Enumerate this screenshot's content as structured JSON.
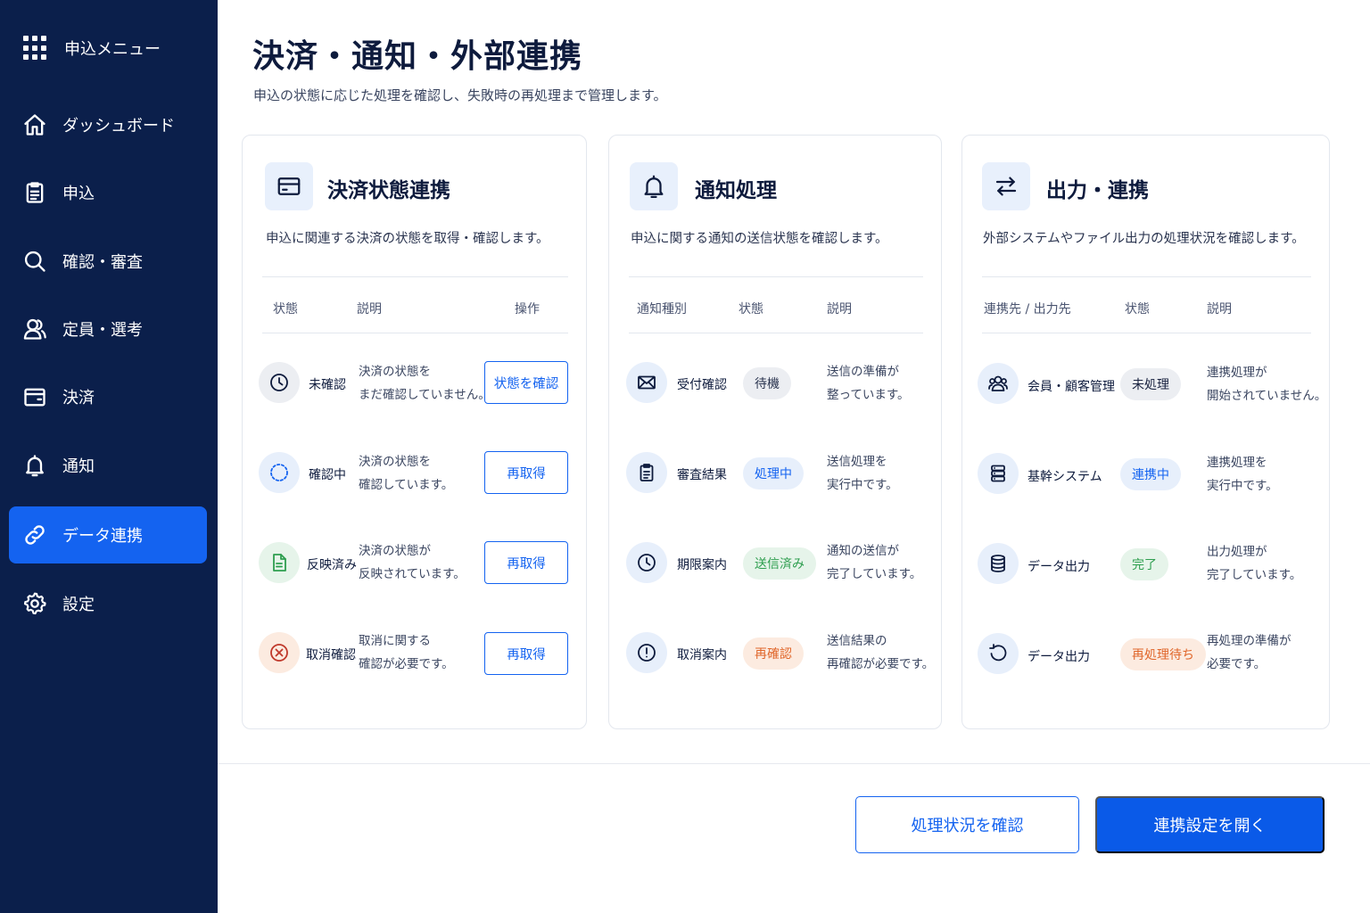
{
  "sidebar": {
    "menu_title": "申込メニュー",
    "items": [
      {
        "label": "ダッシュボード",
        "icon": "home-icon"
      },
      {
        "label": "申込",
        "icon": "clipboard-icon"
      },
      {
        "label": "確認・審査",
        "icon": "search-icon"
      },
      {
        "label": "定員・選考",
        "icon": "users-icon"
      },
      {
        "label": "決済",
        "icon": "wallet-icon"
      },
      {
        "label": "通知",
        "icon": "bell-icon"
      },
      {
        "label": "データ連携",
        "icon": "link-icon",
        "active": true
      },
      {
        "label": "設定",
        "icon": "gear-icon"
      }
    ]
  },
  "header": {
    "title": "決済・通知・外部連携",
    "subtitle": "申込の状態に応じた処理を確認し、失敗時の再処理まで管理します。"
  },
  "cards": {
    "payment": {
      "title": "決済状態連携",
      "icon": "card-icon",
      "description": "申込に関連する決済の状態を取得・確認します。",
      "headers": [
        "状態",
        "説明",
        "操作"
      ],
      "rows": [
        {
          "status": "未確認",
          "desc1": "決済の状態を",
          "desc2": "まだ確認していません。",
          "action": "状態を確認",
          "icon": "clock-icon"
        },
        {
          "status": "確認中",
          "desc1": "決済の状態を",
          "desc2": "確認しています。",
          "action": "再取得",
          "icon": "loading-icon"
        },
        {
          "status": "反映済み",
          "desc1": "決済の状態が",
          "desc2": "反映されています。",
          "action": "再取得",
          "icon": "document-icon"
        },
        {
          "status": "取消確認",
          "desc1": "取消に関する",
          "desc2": "確認が必要です。",
          "action": "再取得",
          "icon": "cancel-icon"
        }
      ]
    },
    "notification": {
      "title": "通知処理",
      "icon": "bell-icon",
      "description": "申込に関する通知の送信状態を確認します。",
      "headers": [
        "通知種別",
        "状態",
        "説明"
      ],
      "rows": [
        {
          "type": "受付確認",
          "status": "待機",
          "desc1": "送信の準備が",
          "desc2": "整っています。",
          "icon": "mail-icon"
        },
        {
          "type": "審査結果",
          "status": "処理中",
          "desc1": "送信処理を",
          "desc2": "実行中です。",
          "icon": "clipboard-icon"
        },
        {
          "type": "期限案内",
          "status": "送信済み",
          "desc1": "通知の送信が",
          "desc2": "完了しています。",
          "icon": "clock-icon"
        },
        {
          "type": "取消案内",
          "status": "再確認",
          "desc1": "送信結果の",
          "desc2": "再確認が必要です。",
          "icon": "alert-icon"
        }
      ]
    },
    "integration": {
      "title": "出力・連携",
      "icon": "swap-icon",
      "description": "外部システムやファイル出力の処理状況を確認します。",
      "headers": [
        "連携先 / 出力先",
        "状態",
        "説明"
      ],
      "rows": [
        {
          "target": "会員・顧客管理",
          "status": "未処理",
          "desc1": "連携処理が",
          "desc2": "開始されていません。",
          "icon": "users-icon"
        },
        {
          "target": "基幹システム",
          "status": "連携中",
          "desc1": "連携処理を",
          "desc2": "実行中です。",
          "icon": "server-icon"
        },
        {
          "target": "データ出力",
          "status": "完了",
          "desc1": "出力処理が",
          "desc2": "完了しています。",
          "icon": "database-icon"
        },
        {
          "target": "データ出力",
          "status": "再処理待ち",
          "desc1": "再処理の準備が",
          "desc2": "必要です。",
          "icon": "refresh-icon"
        }
      ]
    }
  },
  "footer": {
    "secondary_button": "処理状況を確認",
    "primary_button": "連携設定を開く"
  },
  "colors": {
    "sidebar": "#0b1f4b",
    "accent": "#1463f0",
    "green": "#2e9e4f",
    "orange": "#e0662a"
  }
}
